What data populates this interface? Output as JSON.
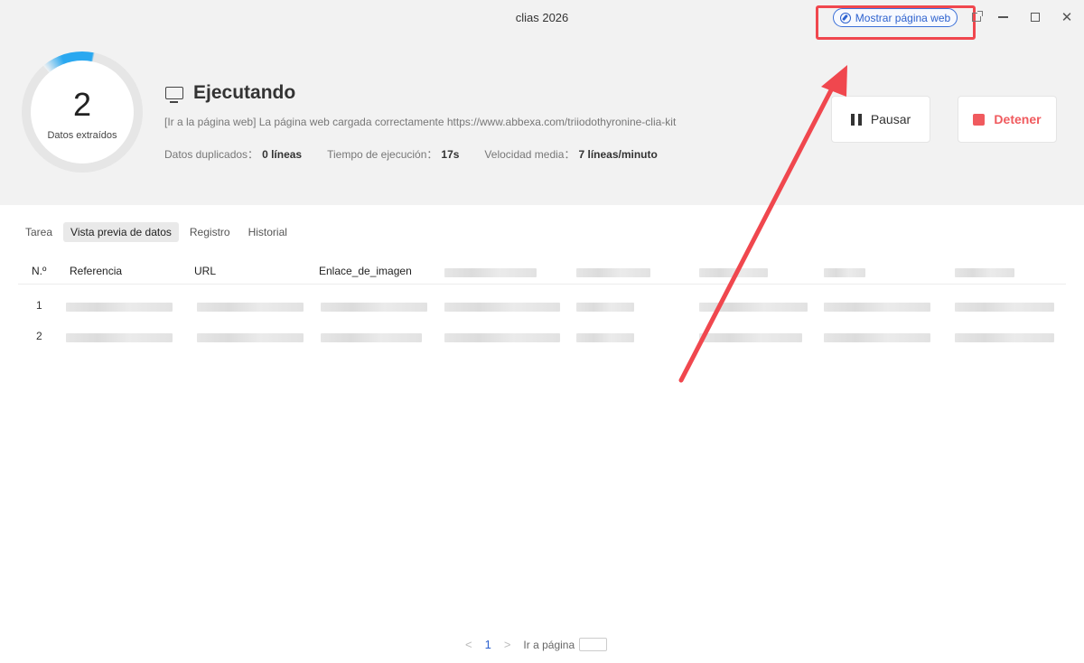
{
  "window": {
    "title": "clias 2026"
  },
  "header": {
    "show_web_label": "Mostrar página web",
    "accent_color": "#2e62cf",
    "highlight_color": "#f0474e"
  },
  "summary": {
    "count": "2",
    "count_label": "Datos extraídos",
    "status_title": "Ejecutando",
    "status_message": "[Ir a la página web] La página web cargada correctamente https://www.abbexa.com/triiodothyronine-clia-kit",
    "stats": [
      {
        "label": "Datos duplicados：",
        "value": "0 líneas"
      },
      {
        "label": "Tiempo de ejecución：",
        "value": "17s"
      },
      {
        "label": "Velocidad media：",
        "value": "7 líneas/minuto"
      }
    ]
  },
  "controls": {
    "pause_label": "Pausar",
    "stop_label": "Detener",
    "stop_color": "#f05a5e"
  },
  "tabs": [
    {
      "label": "Tarea",
      "active": false
    },
    {
      "label": "Vista previa de datos",
      "active": true
    },
    {
      "label": "Registro",
      "active": false
    },
    {
      "label": "Historial",
      "active": false
    }
  ],
  "table": {
    "headers": [
      "N.º",
      "Referencia",
      "URL",
      "Enlace_de_imagen"
    ],
    "rows": [
      {
        "num": "1"
      },
      {
        "num": "2"
      }
    ]
  },
  "pagination": {
    "current": "1",
    "goto_label": "Ir a página"
  },
  "icons": [
    "compass-icon",
    "popout-icon",
    "minimize-icon",
    "maximize-icon",
    "close-icon",
    "monitor-icon",
    "pause-icon",
    "stop-icon",
    "chevron-left-icon",
    "chevron-right-icon"
  ]
}
